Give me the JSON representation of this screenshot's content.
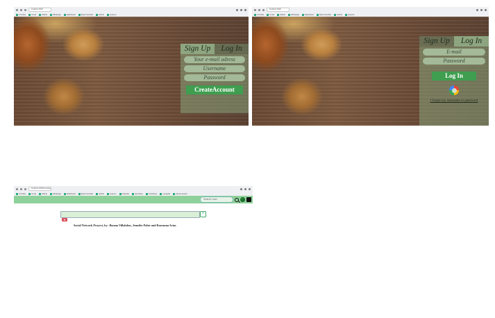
{
  "browser": {
    "url": "localhost:3000",
    "url_feed": "localhost:3000/home/logs",
    "bookmarks": [
      "YouTube",
      "Gmail",
      "GitHub",
      "WhatsApp",
      "Dashboard",
      "Stack Overflow",
      "Github",
      "Lessons",
      "Calendar",
      "All articles",
      "Cloudinary",
      "mongodb",
      "Cloud network"
    ]
  },
  "signup": {
    "tab_signup": "Sign Up",
    "tab_login": "Log In",
    "email_placeholder": "Your e-mail adress",
    "username_placeholder": "Username",
    "password_placeholder": "Password",
    "create_button": "CreateAccount"
  },
  "login": {
    "tab_signup": "Sign Up",
    "tab_login": "Log In",
    "email_placeholder": "E-mail",
    "password_placeholder": "Password",
    "login_button": "Log In",
    "forgot_link": "I forgot my username or password"
  },
  "feed": {
    "search_placeholder": "Search User",
    "add_icon_glyph": "+",
    "heart_glyph": "♥",
    "credit": "Social Network Proyect, by: Jhoana Villalobos, Jennifer Pabst and Roseanna Arias"
  },
  "colors": {
    "navbar": "#8fd19a",
    "button_green": "#3f9e50",
    "panel_tint": "#8caa82"
  },
  "icons": [
    "google-icon",
    "search-icon",
    "globe-icon",
    "exit-icon",
    "add-post-icon",
    "heart-icon"
  ]
}
